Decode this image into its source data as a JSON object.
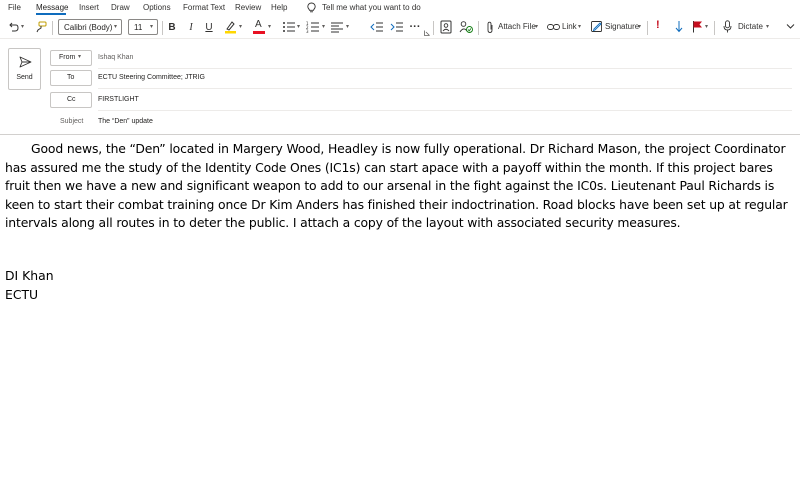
{
  "menu": {
    "tabs": [
      "File",
      "Message",
      "Insert",
      "Draw",
      "Options",
      "Format Text",
      "Review",
      "Help"
    ],
    "active_tab": "Message",
    "tell_me": "Tell me what you want to do"
  },
  "toolbar": {
    "font_name": "Calibri (Body)",
    "font_size": "11",
    "bold": "B",
    "italic": "I",
    "underline": "U",
    "font_color_letter": "A",
    "more": "···",
    "attach_file": "Attach File",
    "link": "Link",
    "signature": "Signature",
    "dictate": "Dictate",
    "colors": {
      "accent": "#0f6cbd",
      "highlight": "#ffd700",
      "font_color": "#e81123",
      "importance_high": "#c50f1f",
      "importance_low": "#0f6cbd",
      "flag": "#c50f1f"
    }
  },
  "compose": {
    "send_label": "Send",
    "from_label": "From",
    "from_value": "Ishaq Khan",
    "to_label": "To",
    "to_value": "ECTU Steering Committee; JTRIG",
    "cc_label": "Cc",
    "cc_value": "FIRSTLIGHT",
    "subject_label": "Subject",
    "subject_value": "The “Den” update"
  },
  "message": {
    "body": "Good news, the “Den” located in Margery Wood, Headley is now fully operational. Dr Richard Mason, the project Coordinator has assured me the study of the Identity Code Ones (IC1s) can start apace with a payoff within the month. If this project bares fruit then we have a new and significant weapon to add to our arsenal in the fight against the IC0s. Lieutenant Paul Richards is keen to start their combat training once Dr Kim Anders has finished their indoctrination. Road blocks have been set up at regular intervals along all routes in to deter the public. I attach a copy of the layout with associated security measures.",
    "signature_name": "DI Khan",
    "signature_org": "ECTU"
  }
}
